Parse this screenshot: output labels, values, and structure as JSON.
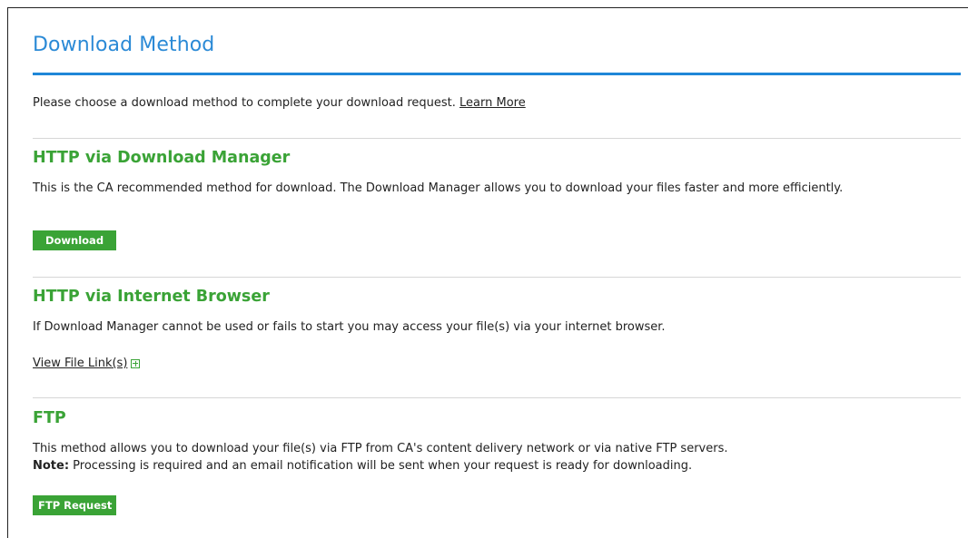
{
  "page": {
    "title": "Download Method",
    "intro_text": "Please choose a download method to complete your download request.",
    "learn_more_label": "Learn More"
  },
  "sections": {
    "http_manager": {
      "title": "HTTP via Download Manager",
      "description": "This is the CA recommended method for download. The Download Manager allows you to download your files faster and more efficiently.",
      "button_label": "Download"
    },
    "http_browser": {
      "title": "HTTP via Internet Browser",
      "description": "If Download Manager cannot be used or fails to start you may access your file(s) via your internet browser.",
      "link_label": "View File Link(s)",
      "expand_icon": "plus-box-icon"
    },
    "ftp": {
      "title": "FTP",
      "description": "This method allows you to download your file(s) via FTP from CA's content delivery network or via native FTP servers.",
      "note_label": "Note:",
      "note_text": " Processing is required and an email notification will be sent when your request is ready for downloading.",
      "button_label": "FTP Request"
    }
  },
  "colors": {
    "title_blue": "#2b8ad6",
    "rule_blue": "#1f87d8",
    "accent_green": "#3aa336"
  }
}
